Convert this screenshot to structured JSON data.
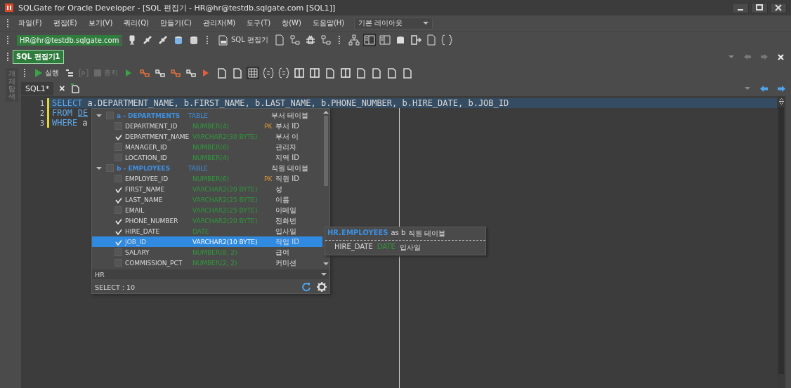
{
  "window": {
    "title": "SQLGate for Oracle Developer - [SQL 편집기 - HR@hr@testdb.sqlgate.com [SQL1]]"
  },
  "menu": [
    "파일(F)",
    "편집(E)",
    "보기(V)",
    "쿼리(Q)",
    "만들기(C)",
    "관리자(M)",
    "도구(T)",
    "창(W)",
    "도움말(H)"
  ],
  "layout_dropdown": {
    "value": "기본 레이아웃"
  },
  "toolbar": {
    "connection": "HR@hr@testdb.sqlgate.com",
    "sql_editor_button": "SQL 편집기"
  },
  "document_tabs": [
    {
      "label": "SQL 편집기1",
      "selected": true
    }
  ],
  "side_panel": {
    "label": "개체 탐색"
  },
  "editor_toolbar": {
    "run": "실행",
    "stop": {
      "label": "중지",
      "disabled": true
    }
  },
  "editor_tabs": [
    {
      "label": "SQL1*",
      "selected": true
    }
  ],
  "close_glyph": "×",
  "code_lines": [
    {
      "number": "1",
      "selected": true,
      "modified": true,
      "tokens": [
        {
          "text": "SELECT",
          "kind": "keyword"
        },
        {
          "text": " a.DEPARTMENT_NAME, b.FIRST_NAME, b.LAST_NAME, b.PHONE_NUMBER, b.HIRE_DATE, b.JOB_ID",
          "kind": "plain"
        }
      ]
    },
    {
      "number": "2",
      "selected": false,
      "modified": true,
      "tokens": [
        {
          "text": "FROM",
          "kind": "keyword"
        },
        {
          "text": "DE",
          "kind": "link"
        }
      ]
    },
    {
      "number": "3",
      "selected": false,
      "modified": true,
      "tokens": [
        {
          "text": "WHERE",
          "kind": "keyword"
        },
        {
          "text": " a",
          "kind": "plain"
        }
      ]
    }
  ],
  "popup": {
    "tables": [
      {
        "name": "a - DEPARTMENTS",
        "type": "TABLE",
        "comment": "부서 테이블",
        "expanded": true,
        "checked": false,
        "columns": [
          {
            "name": "DEPARTMENT_ID",
            "type": "NUMBER(4)",
            "key": "PK",
            "comment": "부서 ID",
            "checked": false,
            "selected": false
          },
          {
            "name": "DEPARTMENT_NAME",
            "type": "VARCHAR2(30 BYTE)",
            "comment": "부서 이",
            "checked": true,
            "selected": false
          },
          {
            "name": "MANAGER_ID",
            "type": "NUMBER(6)",
            "comment": "관리자",
            "checked": false,
            "selected": false
          },
          {
            "name": "LOCATION_ID",
            "type": "NUMBER(4)",
            "comment": "지역 ID",
            "checked": false,
            "selected": false
          }
        ]
      },
      {
        "name": "b - EMPLOYEES",
        "type": "TABLE",
        "comment": "직원 테이블",
        "expanded": true,
        "checked": false,
        "columns": [
          {
            "name": "EMPLOYEE_ID",
            "type": "NUMBER(6)",
            "key": "PK",
            "comment": "직원 ID",
            "checked": false,
            "selected": false
          },
          {
            "name": "FIRST_NAME",
            "type": "VARCHAR2(20 BYTE)",
            "comment": "성",
            "checked": true,
            "selected": false
          },
          {
            "name": "LAST_NAME",
            "type": "VARCHAR2(25 BYTE)",
            "comment": "이름",
            "checked": true,
            "selected": false
          },
          {
            "name": "EMAIL",
            "type": "VARCHAR2(25 BYTE)",
            "comment": "이메일",
            "checked": false,
            "selected": false
          },
          {
            "name": "PHONE_NUMBER",
            "type": "VARCHAR2(20 BYTE)",
            "comment": "전화번",
            "checked": true,
            "selected": false
          },
          {
            "name": "HIRE_DATE",
            "type": "DATE",
            "comment": "입사일",
            "checked": true,
            "selected": false
          },
          {
            "name": "JOB_ID",
            "type": "VARCHAR2(10 BYTE)",
            "comment": "작업 ID",
            "checked": true,
            "selected": true
          },
          {
            "name": "SALARY",
            "type": "NUMBER(8, 2)",
            "comment": "급여",
            "checked": false,
            "selected": false
          },
          {
            "name": "COMMISSION_PCT",
            "type": "NUMBER(2, 2)",
            "comment": "커미션",
            "checked": false,
            "selected": false
          }
        ]
      }
    ],
    "schema": "HR",
    "status": "SELECT : 10"
  },
  "tooltip": {
    "table": "HR.EMPLOYEES",
    "alias": "as b",
    "table_comment": "직원 테이블",
    "column": "HIRE_DATE",
    "type": "DATE",
    "comment": "입사일"
  }
}
